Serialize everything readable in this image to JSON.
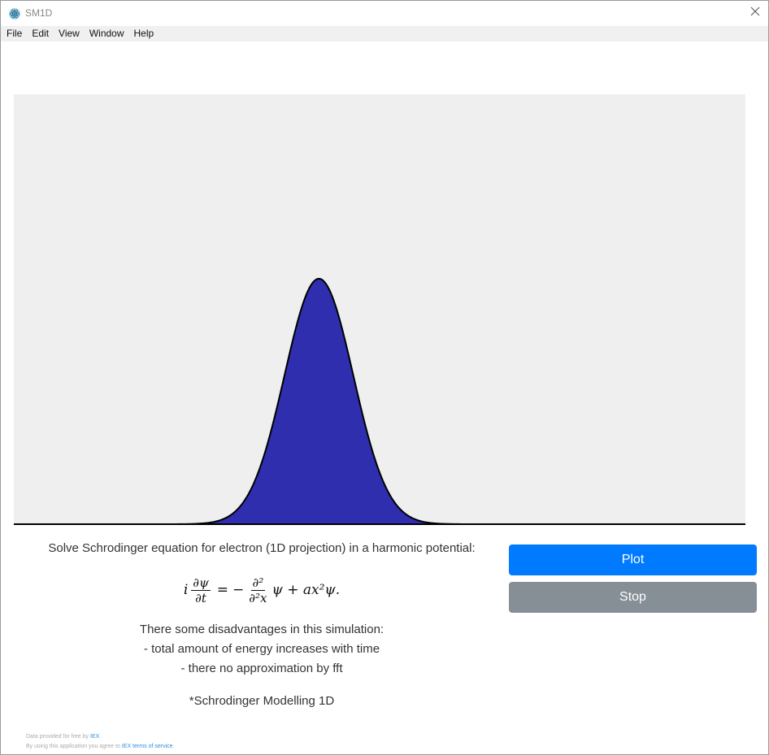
{
  "window": {
    "title": "SM1D",
    "icons": {
      "app": "atom-icon",
      "close": "close-icon"
    }
  },
  "menu": {
    "items": [
      {
        "label": "File"
      },
      {
        "label": "Edit"
      },
      {
        "label": "View"
      },
      {
        "label": "Window"
      },
      {
        "label": "Help"
      }
    ]
  },
  "plot": {
    "fill_color": "#2e2eaf",
    "outline_color": "#000000",
    "background_color": "#efefef",
    "peak_height_fraction": 0.57,
    "peak_position_fraction": 0.417,
    "width_fraction": 0.047
  },
  "description": {
    "intro": "Solve Schrodinger equation for electron (1D projection) in a harmonic potential:",
    "equation": {
      "lhs_prefix": "i",
      "lhs_num": "∂ψ",
      "lhs_den": "∂t",
      "eq": "=",
      "minus": "−",
      "rhs_num": "∂²",
      "rhs_den": "∂²x",
      "rhs_tail": "ψ + ax²ψ."
    },
    "lines": [
      "There some disadvantages in this simulation:",
      "- total amount of energy increases with time",
      "- there no approximation by fft"
    ],
    "footnote": "*Schrodinger Modelling 1D"
  },
  "buttons": {
    "plot_label": "Plot",
    "stop_label": "Stop",
    "plot_color": "#007bff",
    "stop_color": "#868e96"
  },
  "attribution": {
    "line1_prefix": "Data provided for free by ",
    "line1_link": "IEX",
    "line1_suffix": ".",
    "line2_prefix": "By using this application you agree to ",
    "line2_link": "IEX terms of service",
    "line2_suffix": "."
  }
}
